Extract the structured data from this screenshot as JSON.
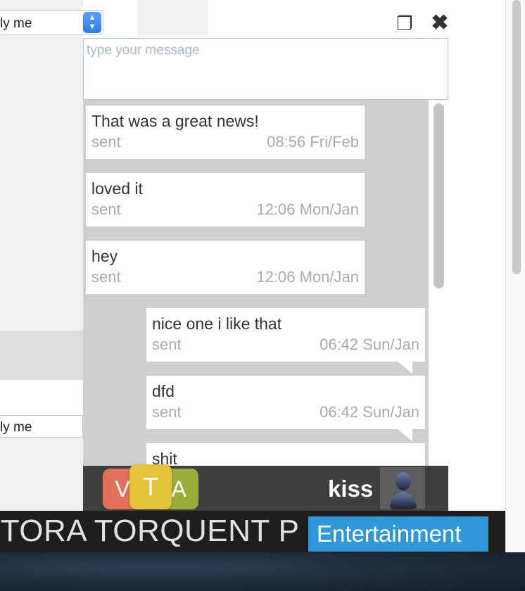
{
  "page": {
    "select_top_value": "ly me",
    "select_bottom_value": "ly me"
  },
  "chat": {
    "input_placeholder": "type your message",
    "messages": [
      {
        "text": "That was a great news!",
        "status": "sent",
        "time": "08:56 Fri/Feb",
        "side": "left"
      },
      {
        "text": "loved it",
        "status": "sent",
        "time": "12:06 Mon/Jan",
        "side": "left"
      },
      {
        "text": "hey",
        "status": "sent",
        "time": "12:06 Mon/Jan",
        "side": "left"
      },
      {
        "text": "nice one i like that",
        "status": "sent",
        "time": "06:42 Sun/Jan",
        "side": "right"
      },
      {
        "text": "dfd",
        "status": "sent",
        "time": "06:42 Sun/Jan",
        "side": "right"
      },
      {
        "text": "shit",
        "status": "",
        "time": "",
        "side": "right"
      }
    ],
    "scroll_position": 0,
    "scroll_visible_fraction": 0.5,
    "bar": {
      "buttons": [
        "V",
        "T",
        "A"
      ],
      "button_colors": {
        "V": "#e0705a",
        "T": "#e4c33a",
        "A": "#9aad38"
      },
      "username": "kiss",
      "avatar_icon": "user-silhouette-icon"
    },
    "icons": {
      "restore": "restore-window-icon",
      "close": "close-icon"
    }
  },
  "ticker": {
    "text": "ITORA TORQUENT P",
    "category": "Entertainment",
    "category_color": "#3097d9"
  }
}
